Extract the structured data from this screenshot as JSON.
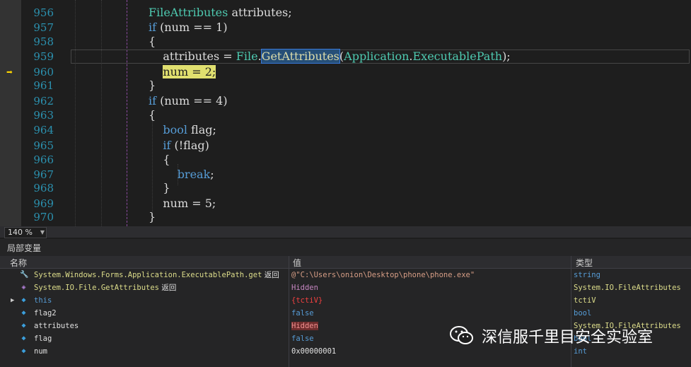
{
  "zoom": "140 %",
  "code_lines": [
    {
      "n": "956",
      "parts": [
        {
          "t": "FileAttributes",
          "c": "ty"
        },
        {
          "t": " attributes;",
          "c": ""
        }
      ]
    },
    {
      "n": "957",
      "parts": [
        {
          "t": "if",
          "c": "kw"
        },
        {
          "t": " (num == 1)",
          "c": ""
        }
      ]
    },
    {
      "n": "958",
      "parts": [
        {
          "t": "{",
          "c": ""
        }
      ]
    },
    {
      "n": "959",
      "parts": [
        {
          "t": "    attributes = ",
          "c": ""
        },
        {
          "t": "File",
          "c": "ty"
        },
        {
          "t": ".",
          "c": ""
        },
        {
          "t": "GetAttributes",
          "c": "fn sel"
        },
        {
          "t": "(",
          "c": ""
        },
        {
          "t": "Application",
          "c": "ty"
        },
        {
          "t": ".",
          "c": ""
        },
        {
          "t": "ExecutablePath",
          "c": "ty"
        },
        {
          "t": ");",
          "c": ""
        }
      ]
    },
    {
      "n": "960",
      "parts": [
        {
          "t": "    ",
          "c": ""
        },
        {
          "t": "num = 2;",
          "c": "hl"
        }
      ]
    },
    {
      "n": "961",
      "parts": [
        {
          "t": "}",
          "c": ""
        }
      ]
    },
    {
      "n": "962",
      "parts": [
        {
          "t": "if",
          "c": "kw"
        },
        {
          "t": " (num == 4)",
          "c": ""
        }
      ]
    },
    {
      "n": "963",
      "parts": [
        {
          "t": "{",
          "c": ""
        }
      ]
    },
    {
      "n": "964",
      "parts": [
        {
          "t": "    ",
          "c": ""
        },
        {
          "t": "bool",
          "c": "kw"
        },
        {
          "t": " flag;",
          "c": ""
        }
      ]
    },
    {
      "n": "965",
      "parts": [
        {
          "t": "    ",
          "c": ""
        },
        {
          "t": "if",
          "c": "kw"
        },
        {
          "t": " (!flag)",
          "c": ""
        }
      ]
    },
    {
      "n": "966",
      "parts": [
        {
          "t": "    {",
          "c": ""
        }
      ]
    },
    {
      "n": "967",
      "parts": [
        {
          "t": "        ",
          "c": ""
        },
        {
          "t": "break",
          "c": "kw"
        },
        {
          "t": ";",
          "c": ""
        }
      ]
    },
    {
      "n": "968",
      "parts": [
        {
          "t": "    }",
          "c": ""
        }
      ]
    },
    {
      "n": "969",
      "parts": [
        {
          "t": "    num = 5;",
          "c": ""
        }
      ]
    },
    {
      "n": "970",
      "parts": [
        {
          "t": "}",
          "c": ""
        }
      ]
    }
  ],
  "locals": {
    "title": "局部变量",
    "col_name": "名称",
    "col_value": "值",
    "col_type": "类型",
    "rows": [
      {
        "icon": "wrench-icon",
        "glyph": "🔧",
        "name": "System.Windows.Forms.Application.ExecutablePath.get",
        "suffix": " 返回",
        "name_color": "yel",
        "value": "@\"C:\\Users\\onion\\Desktop\\phone\\phone.exe\"",
        "value_color": "str",
        "type": "string",
        "type_color": "blue",
        "expand": ""
      },
      {
        "icon": "method-return-icon",
        "glyph": "◈",
        "name": "System.IO.File.GetAttributes",
        "suffix": " 返回",
        "name_color": "yel",
        "value": "Hidden",
        "value_color": "mag",
        "type": "System.IO.FileAttributes",
        "type_color": "yel",
        "expand": ""
      },
      {
        "icon": "field-icon",
        "glyph": "◆",
        "name": "this",
        "suffix": "",
        "name_color": "blue",
        "value": "{tctiV}",
        "value_color": "red",
        "type": "tctiV",
        "type_color": "yel",
        "expand": "▶"
      },
      {
        "icon": "field-icon",
        "glyph": "◆",
        "name": "flag2",
        "suffix": "",
        "name_color": "",
        "value": "false",
        "value_color": "blue",
        "type": "bool",
        "type_color": "blue",
        "expand": ""
      },
      {
        "icon": "field-icon",
        "glyph": "◆",
        "name": "attributes",
        "suffix": "",
        "name_color": "",
        "value": "Hidden",
        "value_color": "chg",
        "type": "System.IO.FileAttributes",
        "type_color": "yel",
        "expand": ""
      },
      {
        "icon": "field-icon",
        "glyph": "◆",
        "name": "flag",
        "suffix": "",
        "name_color": "",
        "value": "false",
        "value_color": "blue",
        "type": "bool",
        "type_color": "blue",
        "expand": ""
      },
      {
        "icon": "field-icon",
        "glyph": "◆",
        "name": "num",
        "suffix": "",
        "name_color": "",
        "value": "0x00000001",
        "value_color": "",
        "type": "int",
        "type_color": "blue",
        "expand": ""
      }
    ]
  },
  "watermark": "深信服千里目安全实验室",
  "colors": {
    "background": "#1e1e1e",
    "line_numbers": "#2b91af",
    "keyword": "#569cd6",
    "type": "#4ec9b0",
    "current_stmt": "#e0df6f"
  }
}
